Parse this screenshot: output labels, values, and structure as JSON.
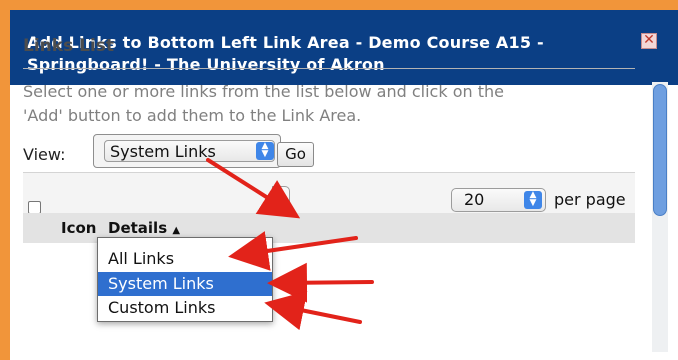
{
  "dialog": {
    "title_line1": "Add Links to Bottom Left Link Area - Demo Course A15 -",
    "title_line2": "Springboard! - The University of Akron",
    "close_glyph": "✕"
  },
  "links_list": {
    "heading": "Links List",
    "description_line1": "Select one or more links from the list below and click on the",
    "description_line2": "'Add' button to add them to the Link Area.",
    "view_label": "View:",
    "view_selected": "System Links",
    "go_label": "Go",
    "view_options": [
      "All Links",
      "System Links",
      "Custom Links"
    ],
    "per_page_value": "20",
    "per_page_label": "per page",
    "columns": {
      "icon": "Icon",
      "details": "Details",
      "sort_indicator": "▲"
    }
  },
  "colors": {
    "title_bar": "#0b3f85",
    "frame": "#f1953a",
    "selection": "#2f6fcf",
    "annotation_arrow": "#e2231a"
  },
  "icons": {
    "close": "close-icon",
    "spinner": "select-spinner-icon",
    "sort": "sort-ascending-icon"
  }
}
